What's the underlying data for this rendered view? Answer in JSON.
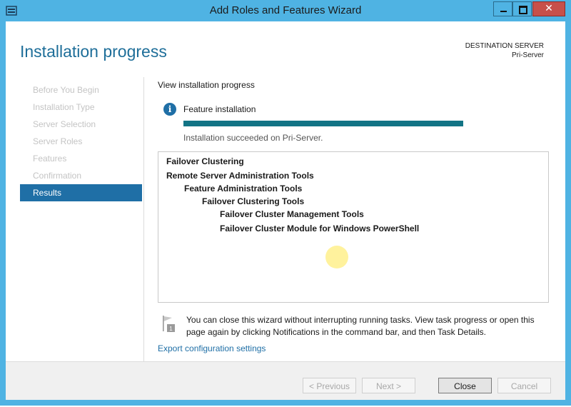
{
  "window": {
    "title": "Add Roles and Features Wizard"
  },
  "page": {
    "title": "Installation progress",
    "destination_label": "DESTINATION SERVER",
    "destination_server": "Pri-Server"
  },
  "nav": {
    "items": [
      {
        "label": "Before You Begin",
        "active": false
      },
      {
        "label": "Installation Type",
        "active": false
      },
      {
        "label": "Server Selection",
        "active": false
      },
      {
        "label": "Server Roles",
        "active": false
      },
      {
        "label": "Features",
        "active": false
      },
      {
        "label": "Confirmation",
        "active": false
      },
      {
        "label": "Results",
        "active": true
      }
    ]
  },
  "main": {
    "view_label": "View installation progress",
    "feature_label": "Feature installation",
    "progress_fraction": 1.0,
    "status": "Installation succeeded on Pri-Server.",
    "results": [
      {
        "text": "Failover Clustering",
        "level": 0
      },
      {
        "text": "Remote Server Administration Tools",
        "level": 0
      },
      {
        "text": "Feature Administration Tools",
        "level": 1
      },
      {
        "text": "Failover Clustering Tools",
        "level": 2
      },
      {
        "text": "Failover Cluster Management Tools",
        "level": 3
      },
      {
        "text": "Failover Cluster Module for Windows PowerShell",
        "level": 3
      }
    ],
    "note": "You can close this wizard without interrupting running tasks. View task progress or open this page again by clicking Notifications in the command bar, and then Task Details.",
    "export_link": "Export configuration settings"
  },
  "footer": {
    "previous": "< Previous",
    "next": "Next >",
    "close": "Close",
    "cancel": "Cancel"
  },
  "colors": {
    "window_frame": "#4fb3e3",
    "accent": "#1f6fa6",
    "progress": "#127485",
    "title": "#1e6e99"
  }
}
